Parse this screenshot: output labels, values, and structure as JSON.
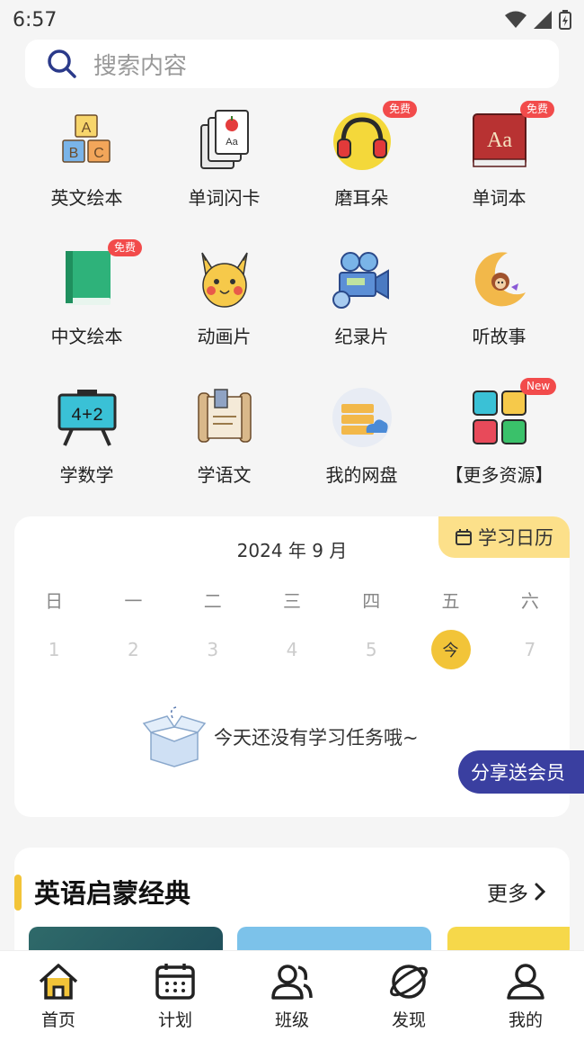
{
  "status": {
    "time": "6:57"
  },
  "search": {
    "placeholder": "搜索内容"
  },
  "grid": [
    {
      "label": "英文绘本",
      "icon": "abc-blocks-icon"
    },
    {
      "label": "单词闪卡",
      "icon": "flashcards-icon"
    },
    {
      "label": "磨耳朵",
      "icon": "headphones-icon",
      "badge": "免费"
    },
    {
      "label": "单词本",
      "icon": "dictionary-icon",
      "badge": "免费"
    },
    {
      "label": "中文绘本",
      "icon": "green-book-icon",
      "badge": "免费"
    },
    {
      "label": "动画片",
      "icon": "pikachu-icon"
    },
    {
      "label": "纪录片",
      "icon": "film-camera-icon"
    },
    {
      "label": "听故事",
      "icon": "moon-monkey-icon"
    },
    {
      "label": "学数学",
      "icon": "math-board-icon"
    },
    {
      "label": "学语文",
      "icon": "scroll-icon"
    },
    {
      "label": "我的网盘",
      "icon": "cloud-drive-icon"
    },
    {
      "label": "【更多资源】",
      "icon": "more-grid-icon",
      "badge": "New"
    }
  ],
  "calendar": {
    "tag": "学习日历",
    "title": "2024 年 9 月",
    "weekdays": [
      "日",
      "一",
      "二",
      "三",
      "四",
      "五",
      "六"
    ],
    "days": [
      "1",
      "2",
      "3",
      "4",
      "5",
      "今",
      "7"
    ],
    "today_index": 5,
    "empty_text": "今天还没有学习任务哦~"
  },
  "share_button": "分享送会员",
  "section": {
    "title": "英语启蒙经典",
    "more": "更多"
  },
  "tabs": [
    {
      "label": "首页",
      "icon": "home-icon"
    },
    {
      "label": "计划",
      "icon": "calendar-icon"
    },
    {
      "label": "班级",
      "icon": "users-icon"
    },
    {
      "label": "发现",
      "icon": "planet-icon"
    },
    {
      "label": "我的",
      "icon": "profile-icon"
    }
  ],
  "colors": {
    "accent": "#f2c438",
    "badge": "#f24b4b",
    "share": "#3a3fa0"
  }
}
